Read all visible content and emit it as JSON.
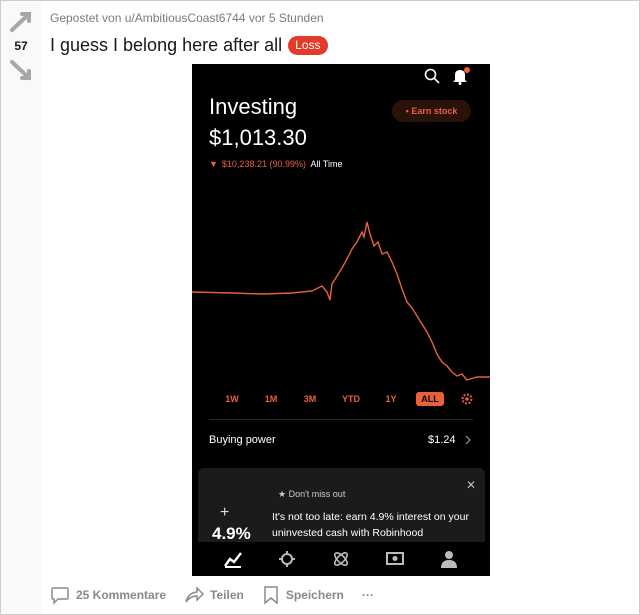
{
  "post": {
    "votes": "57",
    "meta_prefix": "Gepostet von",
    "author": "u/AmbitiousCoast6744",
    "time": "vor 5 Stunden",
    "title": "I guess I belong here after all",
    "flair": "Loss",
    "flair_color": "#e33a2a"
  },
  "screenshot": {
    "title": "Investing",
    "value": "$1,013.30",
    "change": "$10,238.21 (90.99%)",
    "change_period": "All Time",
    "earn_button": "Earn stock",
    "ranges": [
      "1W",
      "1M",
      "3M",
      "YTD",
      "1Y",
      "ALL"
    ],
    "active_range": "ALL",
    "buying_power_label": "Buying power",
    "buying_power_value": "$1.24",
    "card": {
      "close": "✕",
      "header": "Don't miss out",
      "body": "It's not too late: earn 4.9% interest on your uninvested cash with Robinhood",
      "art_text": "4.9%"
    },
    "accent": "#e8613a"
  },
  "actions": {
    "comments": "25 Kommentare",
    "share": "Teilen",
    "save": "Speichern",
    "more": "···"
  }
}
